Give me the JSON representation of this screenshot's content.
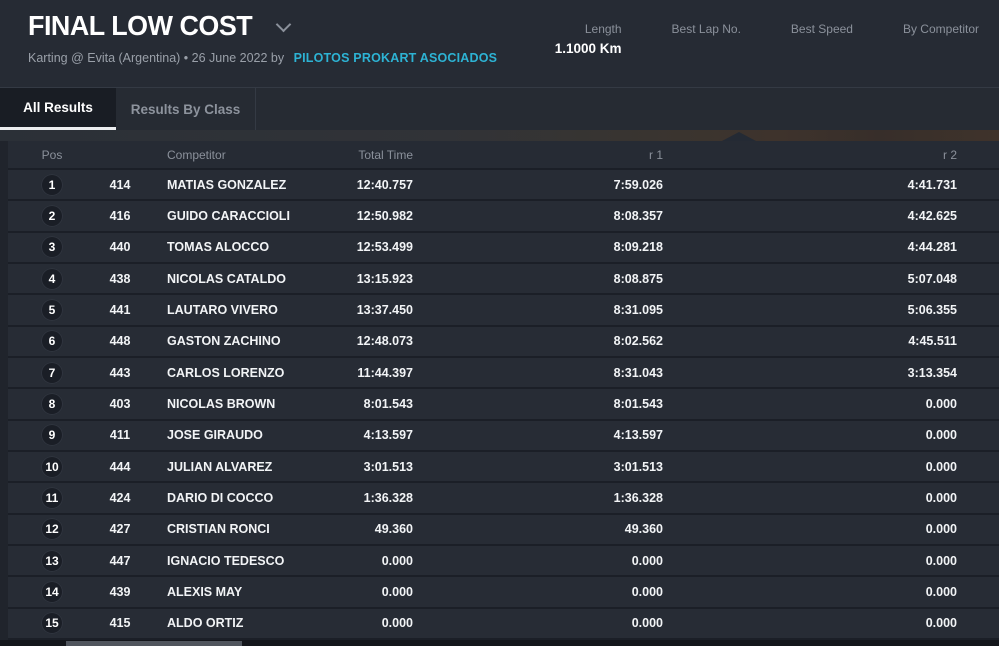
{
  "header": {
    "title": "FINAL LOW COST",
    "subtitle": "Karting @ Evita (Argentina) • 26 June 2022 by",
    "organizer_link": "PILOTOS PROKART ASOCIADOS",
    "stats": [
      {
        "label": "Length",
        "value": "1.1000 Km"
      },
      {
        "label": "Best Lap No.",
        "value": ""
      },
      {
        "label": "Best Speed",
        "value": ""
      },
      {
        "label": "By Competitor",
        "value": ""
      }
    ]
  },
  "tabs": [
    {
      "label": "All Results",
      "active": true
    },
    {
      "label": "Results By Class",
      "active": false
    }
  ],
  "table": {
    "columns": [
      "Pos",
      "Competitor",
      "Total Time",
      "r 1",
      "r 2"
    ],
    "rows": [
      {
        "pos": "1",
        "no": "414",
        "name": "MATIAS GONZALEZ",
        "total": "12:40.757",
        "r1": "7:59.026",
        "r2": "4:41.731"
      },
      {
        "pos": "2",
        "no": "416",
        "name": "GUIDO CARACCIOLI",
        "total": "12:50.982",
        "r1": "8:08.357",
        "r2": "4:42.625"
      },
      {
        "pos": "3",
        "no": "440",
        "name": "TOMAS ALOCCO",
        "total": "12:53.499",
        "r1": "8:09.218",
        "r2": "4:44.281"
      },
      {
        "pos": "4",
        "no": "438",
        "name": "NICOLAS CATALDO",
        "total": "13:15.923",
        "r1": "8:08.875",
        "r2": "5:07.048"
      },
      {
        "pos": "5",
        "no": "441",
        "name": "LAUTARO VIVERO",
        "total": "13:37.450",
        "r1": "8:31.095",
        "r2": "5:06.355"
      },
      {
        "pos": "6",
        "no": "448",
        "name": "GASTON ZACHINO",
        "total": "12:48.073",
        "r1": "8:02.562",
        "r2": "4:45.511"
      },
      {
        "pos": "7",
        "no": "443",
        "name": "CARLOS LORENZO",
        "total": "11:44.397",
        "r1": "8:31.043",
        "r2": "3:13.354"
      },
      {
        "pos": "8",
        "no": "403",
        "name": "NICOLAS BROWN",
        "total": "8:01.543",
        "r1": "8:01.543",
        "r2": "0.000"
      },
      {
        "pos": "9",
        "no": "411",
        "name": "JOSE GIRAUDO",
        "total": "4:13.597",
        "r1": "4:13.597",
        "r2": "0.000"
      },
      {
        "pos": "10",
        "no": "444",
        "name": "JULIAN ALVAREZ",
        "total": "3:01.513",
        "r1": "3:01.513",
        "r2": "0.000"
      },
      {
        "pos": "11",
        "no": "424",
        "name": "DARIO DI COCCO",
        "total": "1:36.328",
        "r1": "1:36.328",
        "r2": "0.000"
      },
      {
        "pos": "12",
        "no": "427",
        "name": "CRISTIAN RONCI",
        "total": "49.360",
        "r1": "49.360",
        "r2": "0.000"
      },
      {
        "pos": "13",
        "no": "447",
        "name": "IGNACIO TEDESCO",
        "total": "0.000",
        "r1": "0.000",
        "r2": "0.000"
      },
      {
        "pos": "14",
        "no": "439",
        "name": "ALEXIS MAY",
        "total": "0.000",
        "r1": "0.000",
        "r2": "0.000"
      },
      {
        "pos": "15",
        "no": "415",
        "name": "ALDO ORTIZ",
        "total": "0.000",
        "r1": "0.000",
        "r2": "0.000"
      }
    ]
  },
  "colors": {
    "link": "#2db3d4",
    "header_bg": "#262b34",
    "row_bg": "#272c35",
    "active_tab_bg": "#191d24",
    "tab_underline": "#eceef0"
  }
}
